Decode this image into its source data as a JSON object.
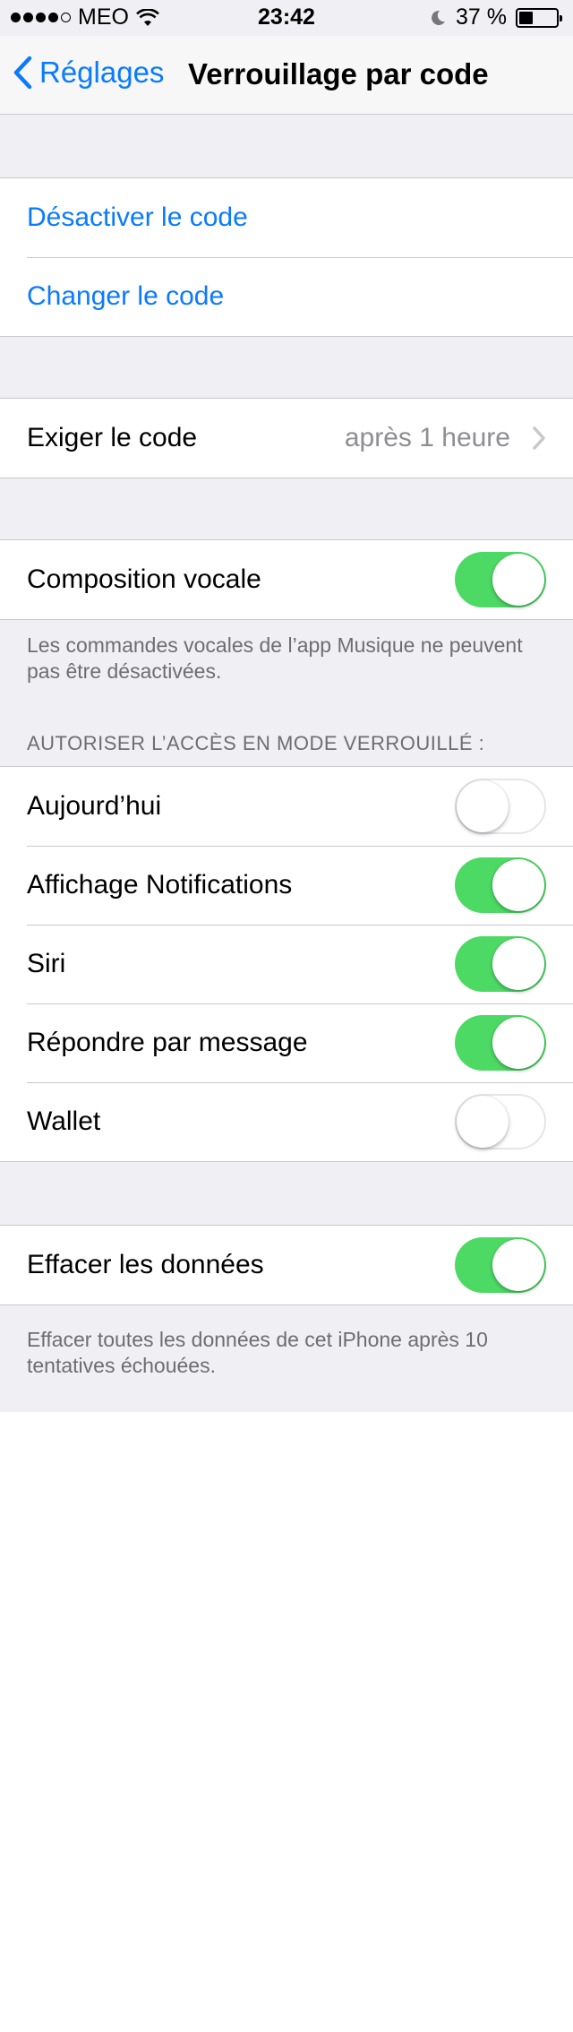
{
  "status_bar": {
    "carrier": "MEO",
    "time": "23:42",
    "battery_percent": "37 %",
    "battery_level": 0.37,
    "signal_dots": [
      true,
      true,
      true,
      true,
      false
    ]
  },
  "navbar": {
    "back_label": "Réglages",
    "title": "Verrouillage par code"
  },
  "code_group": {
    "disable_label": "Désactiver le code",
    "change_label": "Changer le code"
  },
  "require_group": {
    "label": "Exiger le code",
    "value": "après 1 heure"
  },
  "voice_group": {
    "label": "Composition vocale",
    "toggle_on": true,
    "footnote": "Les commandes vocales de l’app Musique ne peuvent pas être désactivées."
  },
  "locked_access": {
    "header": "AUTORISER L’ACCÈS EN MODE VERROUILLÉ :",
    "items": [
      {
        "label": "Aujourd’hui",
        "on": false
      },
      {
        "label": "Affichage Notifications",
        "on": true
      },
      {
        "label": "Siri",
        "on": true
      },
      {
        "label": "Répondre par message",
        "on": true
      },
      {
        "label": "Wallet",
        "on": false
      }
    ]
  },
  "erase_group": {
    "label": "Effacer les données",
    "toggle_on": true,
    "footnote": "Effacer toutes les données de cet iPhone après 10 tentatives échouées."
  },
  "icons": {
    "back": "chevron-left-icon",
    "disclosure": "chevron-right-icon",
    "wifi": "wifi-icon",
    "moon": "moon-icon",
    "battery": "battery-icon"
  },
  "colors": {
    "accent": "#0a7aff",
    "toggle_on": "#4cd964",
    "background": "#efeff4"
  }
}
